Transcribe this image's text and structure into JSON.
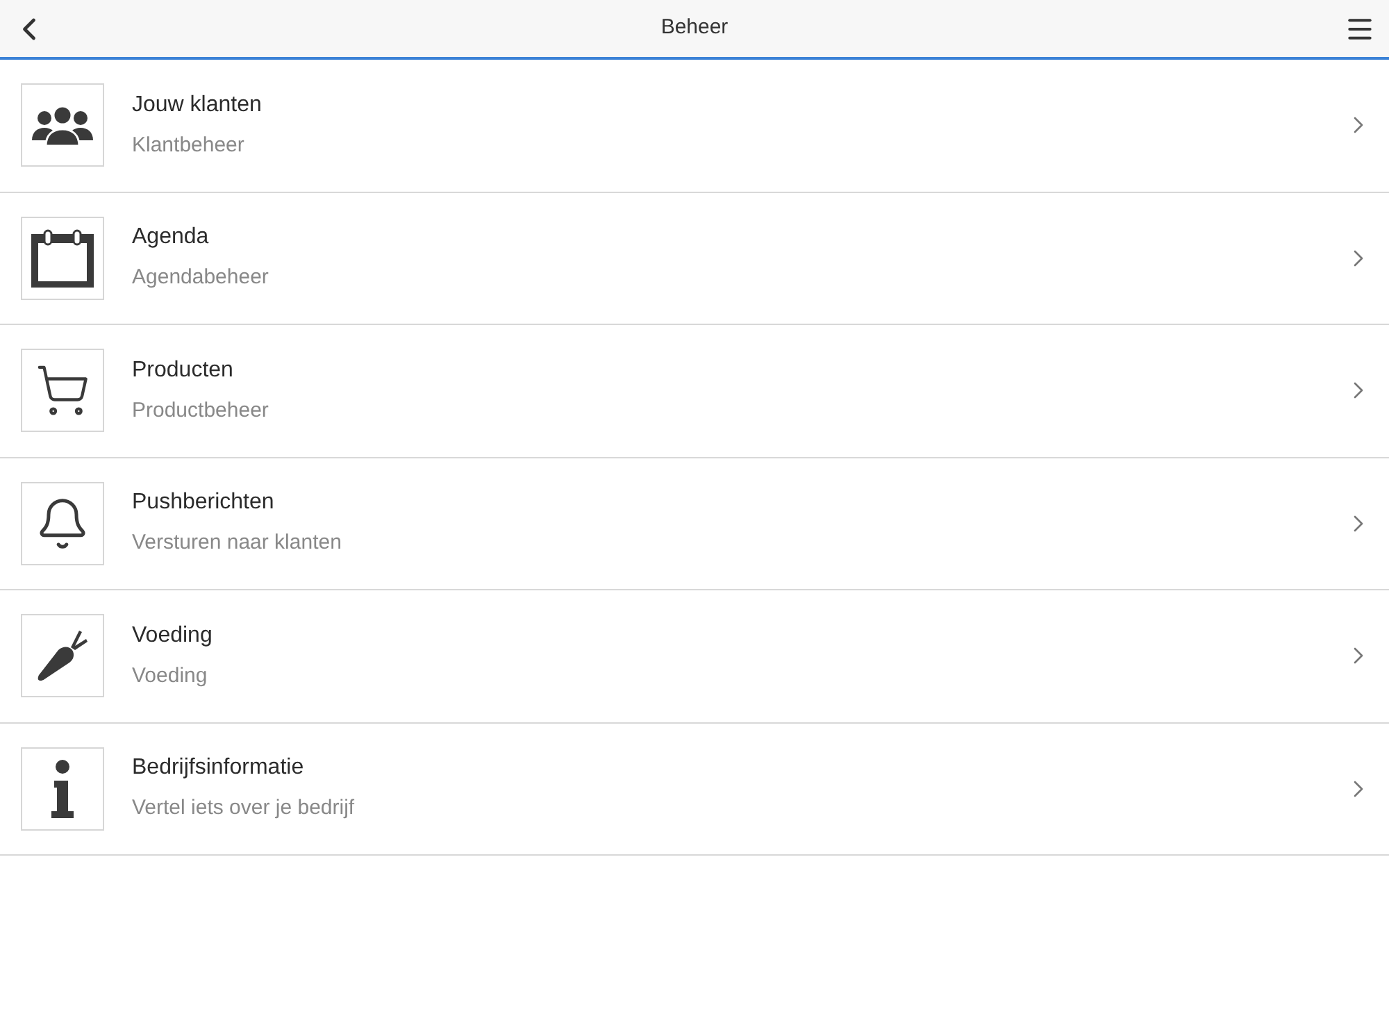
{
  "header": {
    "title": "Beheer"
  },
  "items": [
    {
      "kind": "people",
      "title": "Jouw klanten",
      "subtitle": "Klantbeheer"
    },
    {
      "kind": "calendar",
      "title": "Agenda",
      "subtitle": "Agendabeheer"
    },
    {
      "kind": "cart",
      "title": "Producten",
      "subtitle": "Productbeheer"
    },
    {
      "kind": "bell",
      "title": "Pushberichten",
      "subtitle": "Versturen naar klanten"
    },
    {
      "kind": "carrot",
      "title": "Voeding",
      "subtitle": "Voeding"
    },
    {
      "kind": "info",
      "title": "Bedrijfsinformatie",
      "subtitle": "Vertel iets over je bedrijf"
    }
  ]
}
